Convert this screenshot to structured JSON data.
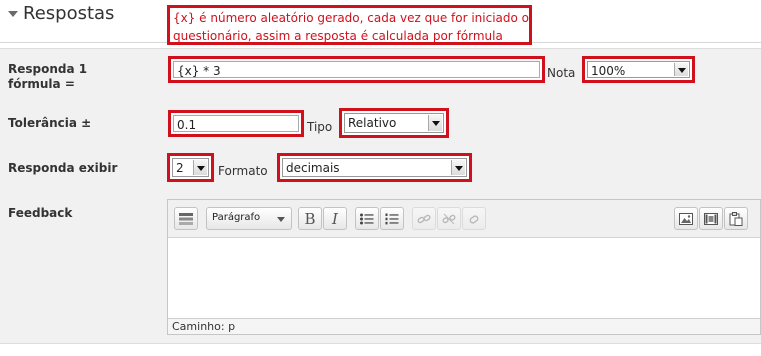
{
  "section": {
    "title": "Respostas",
    "annotation": {
      "line1": "{x} é número aleatório gerado, cada vez que for iniciado o",
      "line2": "questionário, assim a resposta é calculada por fórmula"
    }
  },
  "form": {
    "answer_formula": {
      "label_line1": "Responda 1",
      "label_line2": "fórmula =",
      "value": "{x} * 3"
    },
    "grade": {
      "label": "Nota",
      "selected": "100%"
    },
    "tolerance": {
      "label": "Tolerância ±",
      "value": "0.1"
    },
    "tolerance_type": {
      "label": "Tipo",
      "selected": "Relativo"
    },
    "answer_display": {
      "label": "Responda exibir",
      "selected": "2"
    },
    "format": {
      "label": "Formato",
      "selected": "decimais"
    },
    "feedback": {
      "label": "Feedback",
      "toolbar": {
        "toggle_icon": "toolbar-toggle-icon",
        "paragraph_select": "Parágrafo",
        "bold_icon": "B",
        "italic_icon": "I",
        "unordered_list_icon": "unordered-list-icon",
        "ordered_list_icon": "ordered-list-icon",
        "link_icon": "link-icon",
        "unlink_icon": "unlink-icon",
        "anchor_icon": "anchor-icon",
        "image_icon": "image-icon",
        "media_icon": "media-icon",
        "paste_icon": "paste-icon"
      },
      "path": "Caminho: p"
    }
  },
  "colors": {
    "annotation_red": "#d0111c",
    "panel_background": "#f1f1f1"
  }
}
